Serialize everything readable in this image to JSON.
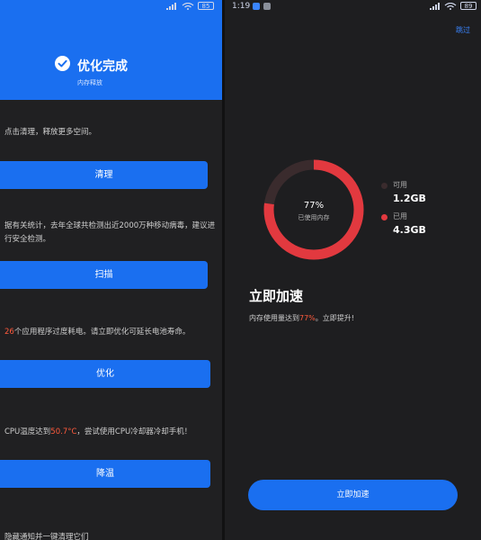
{
  "left": {
    "status": {
      "battery": "85"
    },
    "header": {
      "title": "优化完成",
      "subtitle": "内存释放"
    },
    "cards": {
      "clean": {
        "desc": "点击清理，释放更多空间。",
        "button": "清理"
      },
      "scan": {
        "desc": "据有关统计，去年全球共检测出近2000万种移动病毒，建议进行安全检测。",
        "button": "扫描"
      },
      "optimize": {
        "count": "26",
        "desc": "个应用程序过度耗电。请立即优化可延长电池寿命。",
        "button": "优化"
      },
      "cool": {
        "desc_prefix": "CPU温度达到",
        "temp": "50.7°C",
        "desc_suffix": "，尝试使用CPU冷却器冷却手机！",
        "button": "降温"
      }
    },
    "footer_text": "隐藏通知并一键清理它们"
  },
  "right": {
    "status": {
      "time": "1:19",
      "battery": "89"
    },
    "skip": "跳过",
    "memory": {
      "percent": "77%",
      "percent_value": 77,
      "label": "已使用内存"
    },
    "legend": {
      "available_label": "可用",
      "available_value": "1.2GB",
      "used_label": "已用",
      "used_value": "4.3GB"
    },
    "boost": {
      "title": "立即加速",
      "desc_prefix": "内存使用量达到",
      "desc_pct": "77%",
      "desc_suffix": "。立即提升!",
      "button": "立即加速"
    }
  },
  "colors": {
    "accent_blue": "#1a6ff0",
    "used_red": "#e2393f",
    "free_dark": "#3a2b2d",
    "highlight": "#ff5a3c"
  },
  "icons": [
    "check-icon",
    "signal-icon",
    "wifi-icon",
    "battery-icon"
  ]
}
